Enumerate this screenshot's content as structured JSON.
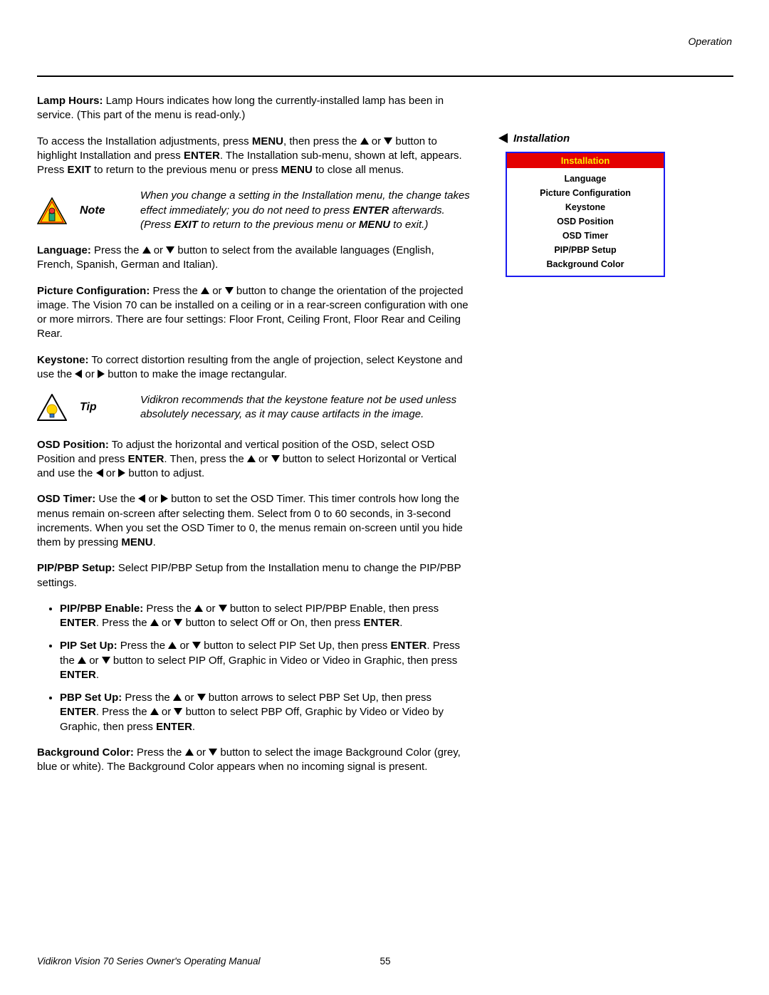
{
  "header": {
    "running": "Operation"
  },
  "sideHead": "Installation",
  "menu": {
    "title": "Installation",
    "items": [
      "Language",
      "Picture Configuration",
      "Keystone",
      "OSD Position",
      "OSD Timer",
      "PIP/PBP Setup",
      "Background Color"
    ]
  },
  "lampHours": {
    "label": "Lamp Hours:",
    "text": " Lamp Hours indicates how long the currently-installed lamp has been in service. (This part of the menu is read-only.)"
  },
  "install": {
    "p1a": "To access the Installation adjustments, press ",
    "menu": "MENU",
    "p1b": ", then press the ",
    "p1c": " or ",
    "p1d": " button to highlight Installation and press ",
    "enter": "ENTER",
    "p1e": ". The Installation sub-menu, shown at left, appears. Press ",
    "exit": "EXIT",
    "p1f": " to return to the previous menu or press ",
    "p1g": " to close all menus."
  },
  "note": {
    "label": "Note",
    "t1": "When you change a setting in the Installation menu, the change takes effect immediately; you do not need to press ",
    "enter": "ENTER",
    "t2": " afterwards. (Press ",
    "exit": "EXIT",
    "t3": " to return to the previous menu or ",
    "menu": "MENU",
    "t4": " to exit.)"
  },
  "language": {
    "label": "Language:",
    "t1": " Press the ",
    "t2": " or ",
    "t3": " button to select from the available languages (English, French, Spanish, German and Italian)."
  },
  "picConf": {
    "label": "Picture Configuration:",
    "t1": " Press the ",
    "t2": " or ",
    "t3": " button to change the orientation of the projected image. The Vision 70 can be installed on a ceiling or in a rear-screen configuration with one or more mirrors. There are four settings: Floor Front, Ceiling Front, Floor Rear and Ceiling Rear."
  },
  "keystone": {
    "label": "Keystone:",
    "t1": " To correct distortion resulting from the angle of projection, select Keystone and use the ",
    "t2": " or ",
    "t3": " button to make the image rectangular."
  },
  "tip": {
    "label": "Tip",
    "text": "Vidikron recommends that the keystone feature not be used unless absolutely necessary, as it may cause artifacts in the image."
  },
  "osdPos": {
    "label": "OSD Position:",
    "t1": " To adjust the horizontal and vertical position of the OSD, select OSD Position and press ",
    "enter": "ENTER",
    "t2": ". Then, press the ",
    "t3": " or ",
    "t4": " button to select Horizontal or Vertical and use the ",
    "t5": " or ",
    "t6": " button to adjust."
  },
  "osdTimer": {
    "label": "OSD Timer:",
    "t1": " Use the ",
    "t2": " or ",
    "t3": " button to set the OSD Timer. This timer controls how long the menus remain on-screen after selecting them. Select from 0 to 60 seconds, in 3-second increments. When you set the OSD Timer to 0, the menus remain on-screen until you hide them by pressing ",
    "menu": "MENU",
    "t4": "."
  },
  "pip": {
    "label": "PIP/PBP Setup:",
    "text": " Select PIP/PBP Setup from the Installation menu to change the PIP/PBP settings."
  },
  "pipEnable": {
    "label": "PIP/PBP Enable:",
    "t1": " Press the ",
    "t2": " or ",
    "t3": " button to select PIP/PBP Enable, then press ",
    "enter": "ENTER",
    "t4": ". Press the ",
    "t5": " or ",
    "t6": " button to select Off or On, then press ",
    "t7": "."
  },
  "pipSetUp": {
    "label": "PIP Set Up:",
    "t1": " Press the ",
    "t2": " or ",
    "t3": " button to select PIP Set Up, then press ",
    "enter": "ENTER",
    "t4": ". Press the ",
    "t5": " or ",
    "t6": " button to select PIP Off, Graphic in Video or Video in Graphic, then press ",
    "t7": "."
  },
  "pbpSetUp": {
    "label": "PBP Set Up:",
    "t1": " Press the ",
    "t2": " or ",
    "t3": " button arrows to select PBP Set Up, then press ",
    "enter": "ENTER",
    "t4": ". Press the ",
    "t5": " or ",
    "t6": " button to select PBP Off, Graphic by Video or Video by Graphic, then press ",
    "t7": "."
  },
  "bgColor": {
    "label": "Background Color:",
    "t1": " Press the ",
    "t2": " or ",
    "t3": " button to select the image Background Color (grey, blue or white). The Background Color appears when no incoming signal is present."
  },
  "footer": {
    "title": "Vidikron Vision 70 Series Owner's Operating Manual",
    "page": "55"
  }
}
